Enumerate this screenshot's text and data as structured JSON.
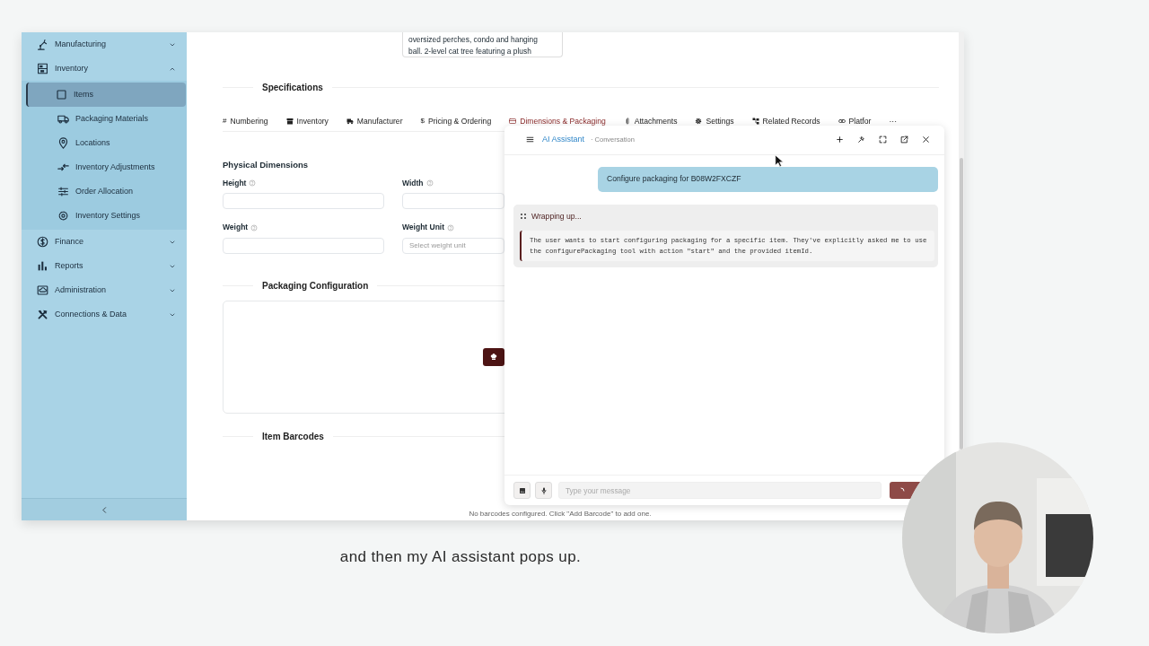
{
  "sidebar": {
    "items": [
      {
        "label": "Manufacturing",
        "expanded": false,
        "selected": false
      },
      {
        "label": "Inventory",
        "expanded": true,
        "selected": false,
        "children": [
          {
            "label": "Items",
            "selected": true
          },
          {
            "label": "Packaging Materials",
            "selected": false
          },
          {
            "label": "Locations",
            "selected": false
          },
          {
            "label": "Inventory Adjustments",
            "selected": false
          },
          {
            "label": "Order Allocation",
            "selected": false
          },
          {
            "label": "Inventory Settings",
            "selected": false
          }
        ]
      },
      {
        "label": "Finance",
        "expanded": false,
        "selected": false
      },
      {
        "label": "Reports",
        "expanded": false,
        "selected": false
      },
      {
        "label": "Administration",
        "expanded": false,
        "selected": false
      },
      {
        "label": "Connections & Data",
        "expanded": false,
        "selected": false
      }
    ]
  },
  "item": {
    "description": "oversized perches, condo and hanging\nball. 2-level cat tree featuring a plush"
  },
  "specifications": {
    "title": "Specifications",
    "tabs": [
      {
        "label": "Numbering",
        "glyph": "#",
        "selected": false
      },
      {
        "label": "Inventory",
        "selected": false
      },
      {
        "label": "Manufacturer",
        "selected": false
      },
      {
        "label": "Pricing & Ordering",
        "glyph": "$",
        "selected": false
      },
      {
        "label": "Dimensions & Packaging",
        "selected": true
      },
      {
        "label": "Attachments",
        "selected": false
      },
      {
        "label": "Settings",
        "selected": false
      },
      {
        "label": "Related Records",
        "selected": false
      },
      {
        "label": "Platfor",
        "selected": false
      }
    ],
    "more": "···"
  },
  "physical_dimensions": {
    "title": "Physical Dimensions",
    "fields": [
      {
        "label": "Height",
        "kind": "input"
      },
      {
        "label": "Width",
        "kind": "input"
      },
      {
        "label": "Weight",
        "kind": "input"
      },
      {
        "label": "Weight Unit",
        "kind": "select",
        "placeholder": "Select weight unit"
      }
    ]
  },
  "packaging_configuration": {
    "title": "Packaging Configuration"
  },
  "item_barcodes": {
    "title": "Item Barcodes",
    "empty_message": "No barcodes configured. Click \"Add Barcode\" to add one."
  },
  "assistant": {
    "title": "AI Assistant",
    "subtitle": "· Conversation",
    "messages": [
      {
        "kind": "user",
        "text": "Configure packaging for B08W2FXCZF"
      },
      {
        "kind": "thinking",
        "status": "Wrapping up...",
        "text": "The user wants to start configuring packaging for a specific item. They've explicitly asked me to use the configurePackaging tool with action \"start\" and the provided itemId."
      }
    ],
    "input": {
      "placeholder": "Type your message"
    },
    "sending": true
  },
  "caption": "and then my AI assistant pops up."
}
